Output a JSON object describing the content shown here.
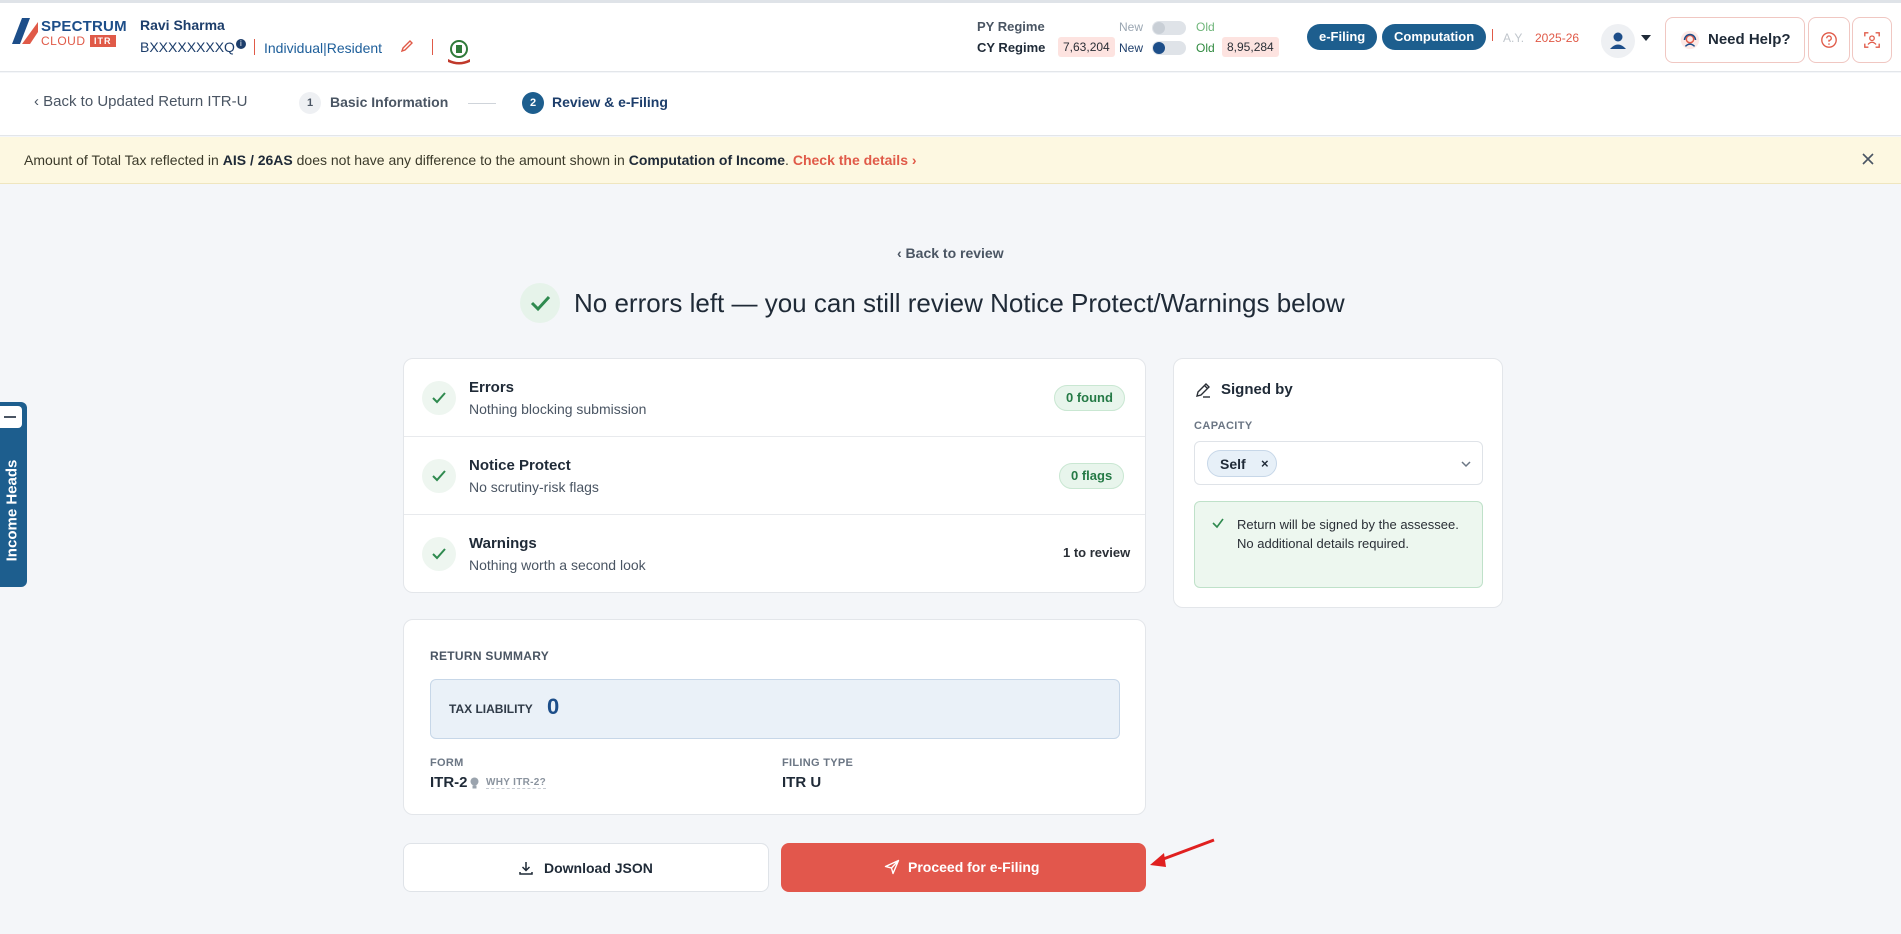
{
  "header": {
    "logo": {
      "line1": "SPECTRUM",
      "line2": "CLOUD",
      "line3": "ITR"
    },
    "user": {
      "name": "Ravi Sharma",
      "pan": "BXXXXXXXXQ",
      "type": "Individual|Resident"
    },
    "regime": {
      "py_label": "PY Regime",
      "cy_label": "CY Regime",
      "new_label": "New",
      "old_label": "Old",
      "cy_new_amount": "7,63,204",
      "cy_old_amount": "8,95,284"
    },
    "buttons": {
      "efiling": "e-Filing",
      "computation": "Computation"
    },
    "ay_label": "A.Y.",
    "ay_value": "2025-26",
    "help_label": "Need Help?"
  },
  "stepper": {
    "back_label": "‹ Back to Updated Return ITR-U",
    "steps": [
      {
        "num": "1",
        "label": "Basic Information"
      },
      {
        "num": "2",
        "label": "Review & e-Filing"
      }
    ]
  },
  "banner": {
    "part1": "Amount of Total Tax reflected in ",
    "bold1": "AIS / 26AS",
    "part2": " does not have any difference to the amount shown in ",
    "bold2": "Computation of Income",
    "part3": ". ",
    "link": "Check the details ›"
  },
  "side_tab": {
    "label": "Income Heads"
  },
  "main": {
    "back_review": "‹ Back to review",
    "headline": "No errors left — you can still review Notice Protect/Warnings below",
    "checks": [
      {
        "title": "Errors",
        "subtitle": "Nothing blocking submission",
        "badge": "0 found"
      },
      {
        "title": "Notice Protect",
        "subtitle": "No scrutiny-risk flags",
        "badge": "0 flags"
      },
      {
        "title": "Warnings",
        "subtitle": "Nothing worth a second look",
        "badge": "1 to review"
      }
    ],
    "summary": {
      "heading": "RETURN SUMMARY",
      "tax_label": "TAX LIABILITY",
      "tax_value": "0",
      "form_label": "FORM",
      "form_value": "ITR-2",
      "why_label": "WHY ITR-2?",
      "filing_label": "FILING TYPE",
      "filing_value": "ITR U"
    },
    "download_label": "Download JSON",
    "proceed_label": "Proceed for e-Filing"
  },
  "signed_by": {
    "title": "Signed by",
    "capacity_label": "CAPACITY",
    "capacity_value": "Self",
    "note": "Return will be signed by the assessee. No additional details required."
  },
  "colors": {
    "brand": "#1d5e8e",
    "accent_red": "#e2574c",
    "success": "#257a46"
  }
}
